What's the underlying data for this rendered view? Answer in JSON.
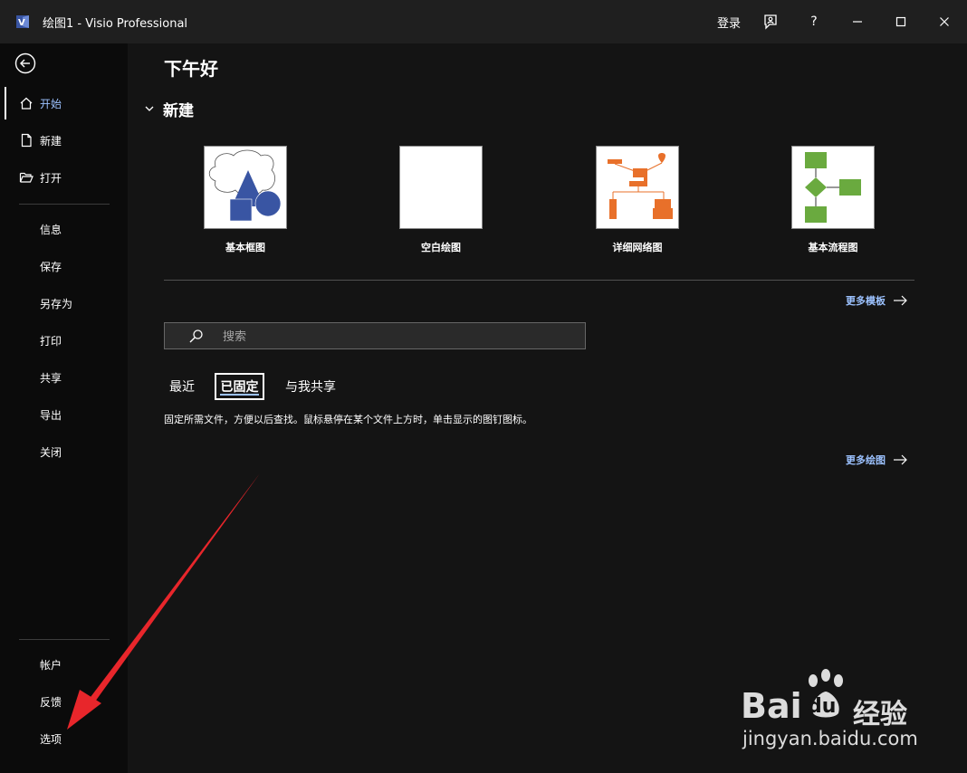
{
  "titlebar": {
    "title": "绘图1  -  Visio Professional",
    "login": "登录",
    "help": "?"
  },
  "colors": {
    "accent": "#9cc2ff",
    "visio_blue": "#3955a3",
    "annotation_red": "#e8262b"
  },
  "sidebar": {
    "items": [
      {
        "label": "开始",
        "icon": "home-icon",
        "active": true
      },
      {
        "label": "新建",
        "icon": "new-file-icon"
      },
      {
        "label": "打开",
        "icon": "open-folder-icon"
      },
      {
        "label": "信息"
      },
      {
        "label": "保存"
      },
      {
        "label": "另存为"
      },
      {
        "label": "打印"
      },
      {
        "label": "共享"
      },
      {
        "label": "导出"
      },
      {
        "label": "关闭"
      }
    ],
    "bottom_items": [
      {
        "label": "帐户"
      },
      {
        "label": "反馈"
      },
      {
        "label": "选项"
      }
    ]
  },
  "main": {
    "greeting": "下午好",
    "new_section": "新建",
    "templates": [
      {
        "label": "基本框图"
      },
      {
        "label": "空白绘图"
      },
      {
        "label": "详细网络图"
      },
      {
        "label": "基本流程图"
      }
    ],
    "more_templates": "更多模板",
    "search": {
      "placeholder": "搜索",
      "value": ""
    },
    "tabs": [
      {
        "label": "最近"
      },
      {
        "label": "已固定",
        "selected": true
      },
      {
        "label": "与我共享"
      }
    ],
    "pinned_description": "固定所需文件，方便以后查找。鼠标悬停在某个文件上方时，单击显示的图钉图标。",
    "more_drawings": "更多绘图"
  },
  "watermark": {
    "brand": "Bai",
    "brand2": "du",
    "cn": "经验",
    "url": "jingyan.baidu.com"
  }
}
